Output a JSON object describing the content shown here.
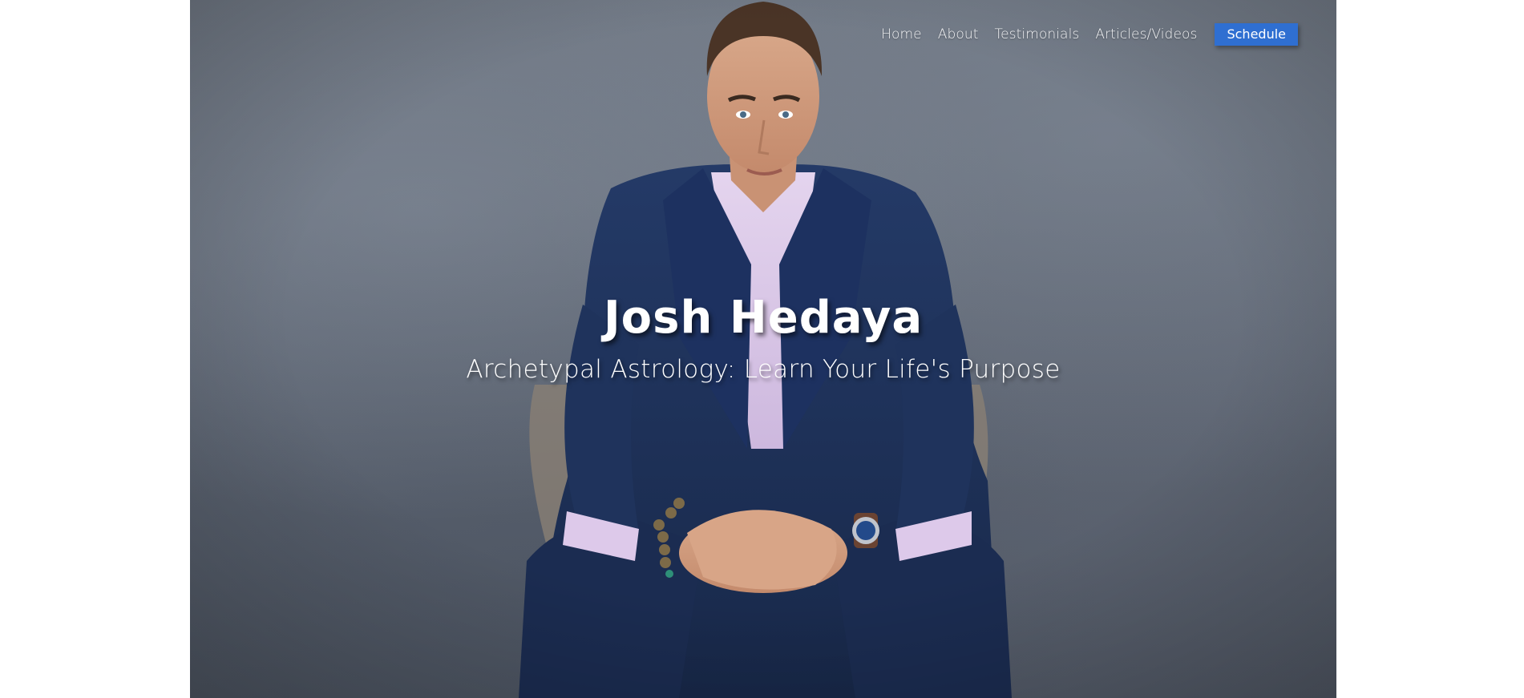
{
  "nav": {
    "items": [
      {
        "label": "Home"
      },
      {
        "label": "About"
      },
      {
        "label": "Testimonials"
      },
      {
        "label": "Articles/Videos"
      }
    ],
    "cta_label": "Schedule"
  },
  "hero": {
    "title": "Josh Hedaya",
    "subtitle": "Archetypal Astrology: Learn Your Life's Purpose"
  },
  "colors": {
    "background_slate": "#626a77",
    "cta_blue": "#2f6fd1",
    "suit_navy": "#1f2f55",
    "shirt_lavender": "#dccbe8",
    "text_white": "#ffffff"
  }
}
